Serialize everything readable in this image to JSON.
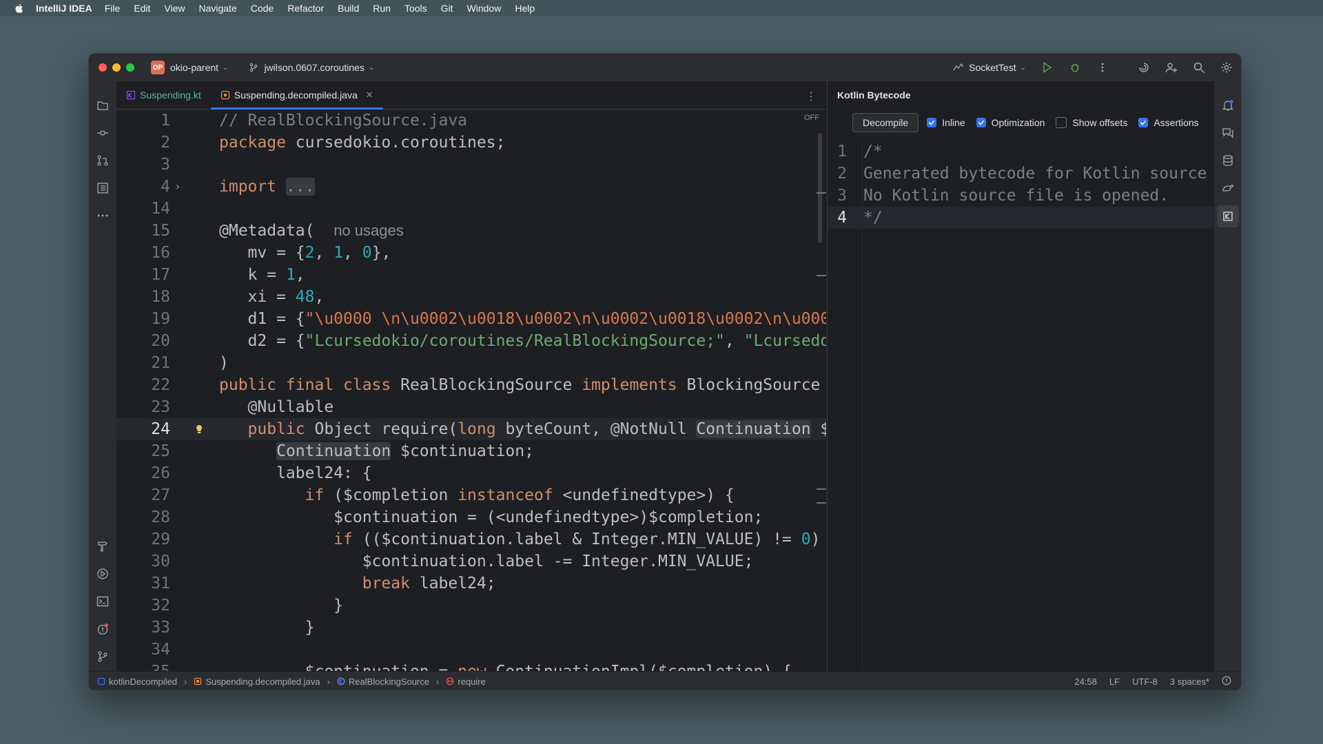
{
  "menubar": {
    "app_name": "IntelliJ IDEA",
    "items": [
      "File",
      "Edit",
      "View",
      "Navigate",
      "Code",
      "Refactor",
      "Build",
      "Run",
      "Tools",
      "Git",
      "Window",
      "Help"
    ]
  },
  "titlebar": {
    "project_badge": "OP",
    "project_name": "okio-parent",
    "branch": "jwilson.0607.coroutines",
    "run_config": "SocketTest"
  },
  "editor": {
    "tabs": [
      {
        "label": "Suspending.kt",
        "active": false
      },
      {
        "label": "Suspending.decompiled.java",
        "active": true
      }
    ],
    "reader_mode": "OFF",
    "current_line": "24"
  },
  "bytecode_panel": {
    "title": "Kotlin Bytecode",
    "decompile_label": "Decompile",
    "options": [
      {
        "label": "Inline",
        "checked": true
      },
      {
        "label": "Optimization",
        "checked": true
      },
      {
        "label": "Show offsets",
        "checked": false
      },
      {
        "label": "Assertions",
        "checked": true
      }
    ],
    "lines": [
      {
        "n": "1",
        "text": "/*"
      },
      {
        "n": "2",
        "text": "Generated bytecode for Kotlin source f"
      },
      {
        "n": "3",
        "text": "No Kotlin source file is opened."
      },
      {
        "n": "4",
        "text": "*/"
      }
    ]
  },
  "statusbar": {
    "breadcrumbs": [
      "kotlinDecompiled",
      "Suspending.decompiled.java",
      "RealBlockingSource",
      "require"
    ],
    "position": "24:58",
    "line_ending": "LF",
    "encoding": "UTF-8",
    "indent": "3 spaces*"
  },
  "colors": {
    "keyword": "#cf8e6d",
    "comment": "#7a7e85",
    "number": "#2aacb8",
    "string": "#6aab73",
    "accent": "#3574f0"
  }
}
